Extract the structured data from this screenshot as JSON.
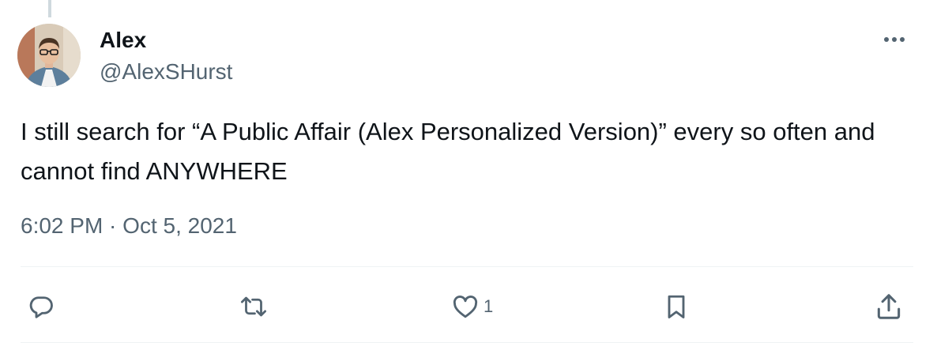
{
  "tweet": {
    "author_name": "Alex",
    "author_handle": "@AlexSHurst",
    "text": "I still search for “A Public Affair (Alex Personalized Version)” every so often and cannot find ANYWHERE",
    "timestamp": "6:02 PM · Oct 5, 2021",
    "like_count": "1"
  },
  "icons": {
    "more": "more-horizontal-icon",
    "reply": "reply-bubble-icon",
    "retweet": "retweet-icon",
    "like": "heart-icon",
    "bookmark": "bookmark-icon",
    "share": "share-upload-icon"
  },
  "colors": {
    "text_primary": "#0f1419",
    "text_secondary": "#536471",
    "divider": "#eff3f4"
  }
}
